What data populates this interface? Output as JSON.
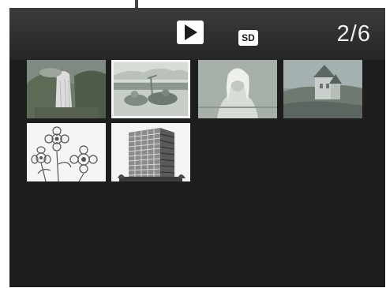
{
  "status_bar": {
    "mode_icon": "play-icon",
    "media_icon": "sd-card-icon",
    "media_label": "SD",
    "frame_counter": "2/6"
  },
  "thumbnails": [
    {
      "icon": "waterfall-photo-thumbnail",
      "selected": false
    },
    {
      "icon": "beach-scene-photo-thumbnail",
      "selected": true
    },
    {
      "icon": "portrait-photo-thumbnail",
      "selected": false
    },
    {
      "icon": "castle-photo-thumbnail",
      "selected": false
    },
    {
      "icon": "flowers-sketch-thumbnail",
      "selected": false
    },
    {
      "icon": "building-photo-thumbnail",
      "selected": false
    }
  ],
  "colors": {
    "screen_bg": "#1d1d1d",
    "selection_border": "#f2f2f2",
    "text": "#f0f0f0"
  }
}
